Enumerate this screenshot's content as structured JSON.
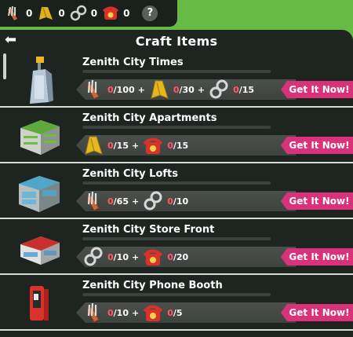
{
  "resources": [
    {
      "icon": "scissors-tools-icon",
      "count": "0"
    },
    {
      "icon": "cape-icon",
      "count": "0"
    },
    {
      "icon": "handcuffs-icon",
      "count": "0"
    },
    {
      "icon": "phone-icon",
      "count": "0"
    }
  ],
  "help_label": "?",
  "panel": {
    "title": "Craft Items",
    "back_glyph": "⬅"
  },
  "button_label": "Get It Now!",
  "items": [
    {
      "name": "Zenith City Times",
      "building_icon": "newspaper-tower-icon",
      "materials": [
        {
          "icon": "scissors-tools-icon",
          "current": "0",
          "required": "/100"
        },
        {
          "icon": "cape-icon",
          "current": "0",
          "required": "/30"
        },
        {
          "icon": "handcuffs-icon",
          "current": "0",
          "required": "/15"
        }
      ]
    },
    {
      "name": "Zenith City Apartments",
      "building_icon": "apartments-building-icon",
      "materials": [
        {
          "icon": "cape-icon",
          "current": "0",
          "required": "/15"
        },
        {
          "icon": "phone-icon",
          "current": "0",
          "required": "/15"
        }
      ]
    },
    {
      "name": "Zenith City Lofts",
      "building_icon": "lofts-building-icon",
      "materials": [
        {
          "icon": "scissors-tools-icon",
          "current": "0",
          "required": "/65"
        },
        {
          "icon": "handcuffs-icon",
          "current": "0",
          "required": "/10"
        }
      ]
    },
    {
      "name": "Zenith City Store Front",
      "building_icon": "store-front-icon",
      "materials": [
        {
          "icon": "handcuffs-icon",
          "current": "0",
          "required": "/10"
        },
        {
          "icon": "phone-icon",
          "current": "0",
          "required": "/20"
        }
      ]
    },
    {
      "name": "Zenith City Phone Booth",
      "building_icon": "phone-booth-icon",
      "materials": [
        {
          "icon": "scissors-tools-icon",
          "current": "0",
          "required": "/10"
        },
        {
          "icon": "phone-icon",
          "current": "0",
          "required": "/5"
        }
      ]
    }
  ],
  "plus_sign": "+"
}
